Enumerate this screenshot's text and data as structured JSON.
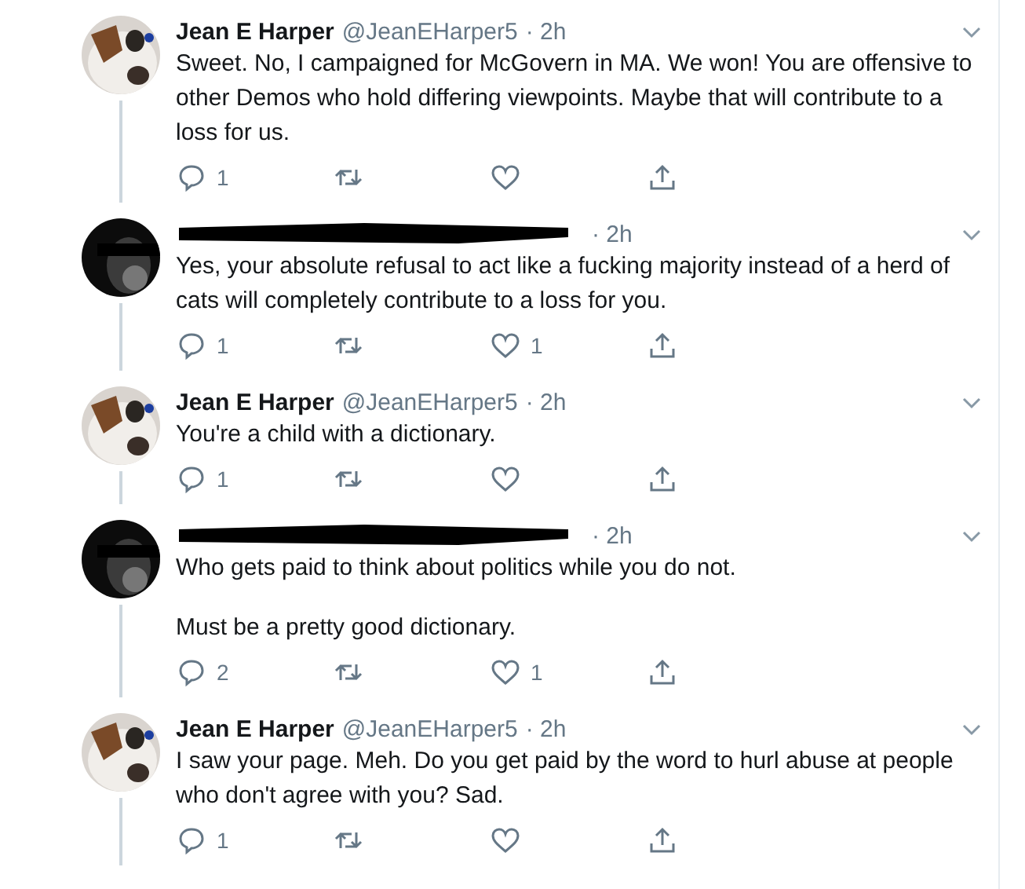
{
  "tweets": [
    {
      "author": {
        "kind": "named",
        "name": "Jean E Harper",
        "handle": "@JeanEHarper5"
      },
      "time": "· 2h",
      "paragraphs": [
        "Sweet. No, I campaigned for McGovern in MA. We won! You are offensive to other Demos who hold differing viewpoints. Maybe that will contribute to a loss for us."
      ],
      "replies": "1"
    },
    {
      "author": {
        "kind": "redacted"
      },
      "time": "· 2h",
      "paragraphs": [
        "Yes, your absolute refusal to act like a fucking majority instead of a herd of cats will completely contribute to a loss for you."
      ],
      "replies": "1",
      "likes": "1"
    },
    {
      "author": {
        "kind": "named",
        "name": "Jean E Harper",
        "handle": "@JeanEHarper5"
      },
      "time": "· 2h",
      "paragraphs": [
        "You're a child with a dictionary."
      ],
      "replies": "1"
    },
    {
      "author": {
        "kind": "redacted"
      },
      "time": "· 2h",
      "paragraphs": [
        "Who gets paid to think about politics while you do not.",
        "Must be a pretty good dictionary."
      ],
      "replies": "2",
      "likes": "1"
    },
    {
      "author": {
        "kind": "named",
        "name": "Jean E Harper",
        "handle": "@JeanEHarper5"
      },
      "time": "· 2h",
      "paragraphs": [
        "I saw your page. Meh. Do you get paid by the word to hurl abuse at people who don't agree with you? Sad."
      ],
      "replies": "1"
    }
  ]
}
